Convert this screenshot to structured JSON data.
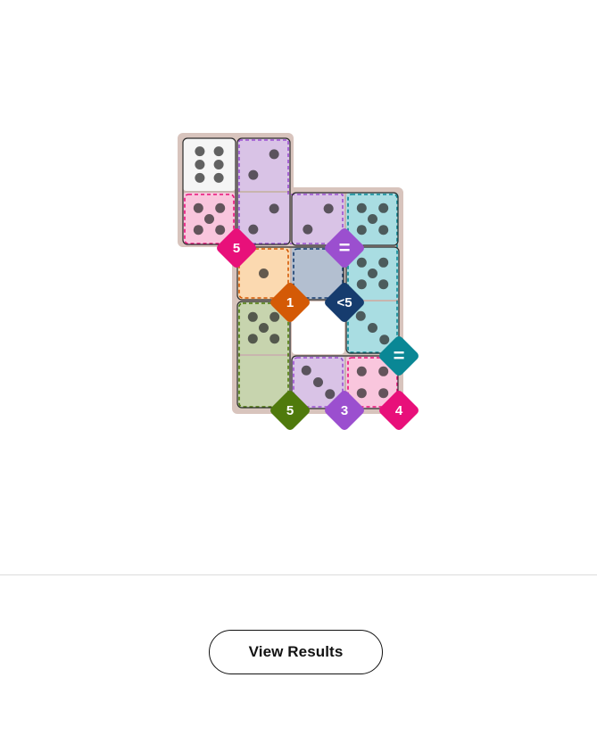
{
  "puzzle": {
    "dominoes": [
      {
        "name": "domino-white-pink",
        "pips": [
          6,
          5
        ]
      },
      {
        "name": "domino-purple-vertical",
        "pips": [
          2,
          2
        ]
      },
      {
        "name": "domino-purple-teal",
        "pips": [
          2,
          5
        ]
      },
      {
        "name": "domino-orange-blue",
        "pips": [
          1,
          0
        ]
      },
      {
        "name": "domino-teal-vertical",
        "pips": [
          5,
          3
        ]
      },
      {
        "name": "domino-green-vertical",
        "pips": [
          5,
          0
        ]
      },
      {
        "name": "domino-purple-pink",
        "pips": [
          3,
          4
        ]
      }
    ],
    "regions": [
      {
        "name": "region-pink-top",
        "color": "#e8107a",
        "fill": "#f9c6dd",
        "badge": "5"
      },
      {
        "name": "region-purple-equal",
        "color": "#9b4fcf",
        "fill": "#d9c3e6",
        "badge": "="
      },
      {
        "name": "region-orange",
        "color": "#d45a06",
        "fill": "#fbd9b0",
        "badge": "1"
      },
      {
        "name": "region-navy",
        "color": "#163c6e",
        "fill": "#b3bfd0",
        "badge": "<5"
      },
      {
        "name": "region-teal",
        "color": "#0a8795",
        "fill": "#a9dde2",
        "badge": "="
      },
      {
        "name": "region-green",
        "color": "#4f7a0c",
        "fill": "#c7d4ae",
        "badge": "5"
      },
      {
        "name": "region-purple-bottom",
        "color": "#9b4fcf",
        "fill": "#d9c3e6",
        "badge": "3"
      },
      {
        "name": "region-pink-bottom",
        "color": "#e8107a",
        "fill": "#f9c6dd",
        "badge": "4"
      }
    ],
    "neutral_fill": "#f5f5f5",
    "board_border_color": "#d8c4bd"
  },
  "footer": {
    "view_results_label": "View Results"
  }
}
